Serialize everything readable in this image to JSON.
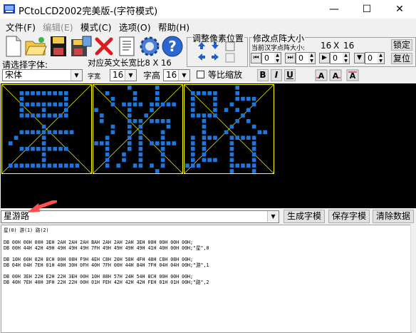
{
  "window": {
    "title": "PCtoLCD2002完美版-(字符模式)",
    "minimize_glyph": "—",
    "maximize_glyph": "☐",
    "close_glyph": "✕"
  },
  "menu": [
    {
      "label": "文件(F)"
    },
    {
      "label": "编辑(E)"
    },
    {
      "label": "模式(C)"
    },
    {
      "label": "选项(O)"
    },
    {
      "label": "帮助(H)"
    }
  ],
  "toolbar": {
    "icons": [
      "new-file-icon",
      "open-folder-icon",
      "save-icon",
      "save-as-icon",
      "delete-icon",
      "document-icon",
      "settings-gear-icon",
      "help-icon"
    ]
  },
  "adjust_pixel": {
    "title": "调整像素位置"
  },
  "dot_size": {
    "title": "修改点阵大小",
    "current_label": "当前汉字点阵大小:",
    "width": "16",
    "times": "X",
    "height": "16",
    "lock_label": "锁定",
    "reset_label": "复位",
    "spinners": [
      "0",
      "0",
      "0",
      "0"
    ]
  },
  "font_row": {
    "select_font_label": "请选择字体:",
    "ascii_width_label": "对应英文长宽比8 X 16",
    "font_value": "宋体",
    "width_label": "字宽",
    "width_value": "16",
    "height_label": "字高",
    "height_value": "16",
    "proportional_label": "等比缩放",
    "bold_label": "B",
    "italic_label": "I",
    "underline_label": "U"
  },
  "glyphs": [
    "星",
    "游",
    "路"
  ],
  "input_row": {
    "text_value": "星游路",
    "generate_label": "生成字模",
    "save_label": "保存字模",
    "clear_label": "清除数据"
  },
  "output": {
    "header": "星(0) 游(1) 路(2)",
    "lines": [
      "DB 00H 00H 00H 3EH 2AH 2AH 2AH BAH 2AH 2AH 2AH 3EH 00H 00H 00H 00H;",
      "DB 00H 44H 42H 49H 49H 49H 49H 7FH 49H 49H 49H 49H 41H 40H 00H 00H;\"星\",0",
      "",
      "DB 10H 60H 02H 8CH 00H 08H F9H 4EH C8H 20H 58H 4FH 48H C8H 08H 00H;",
      "DB 04H 04H 7EH 01H 40H 30H 0FH 40H 7FH 00H 44H 84H 7FH 04H 04H 00H;\"游\",1",
      "",
      "DB 00H 3EH 22H E2H 22H 3EH 00H 10H 88H 57H 24H 54H 8CH 00H 00H 00H;",
      "DB 40H 7EH 40H 3FH 22H 22H 00H 01H FEH 42H 42H 42H FEH 01H 01H 00H;\"路\",2"
    ]
  },
  "accent_colors": {
    "dot": "#1e78dc",
    "grid": "#ffff00",
    "annotation_arrow": "#ff4444"
  }
}
